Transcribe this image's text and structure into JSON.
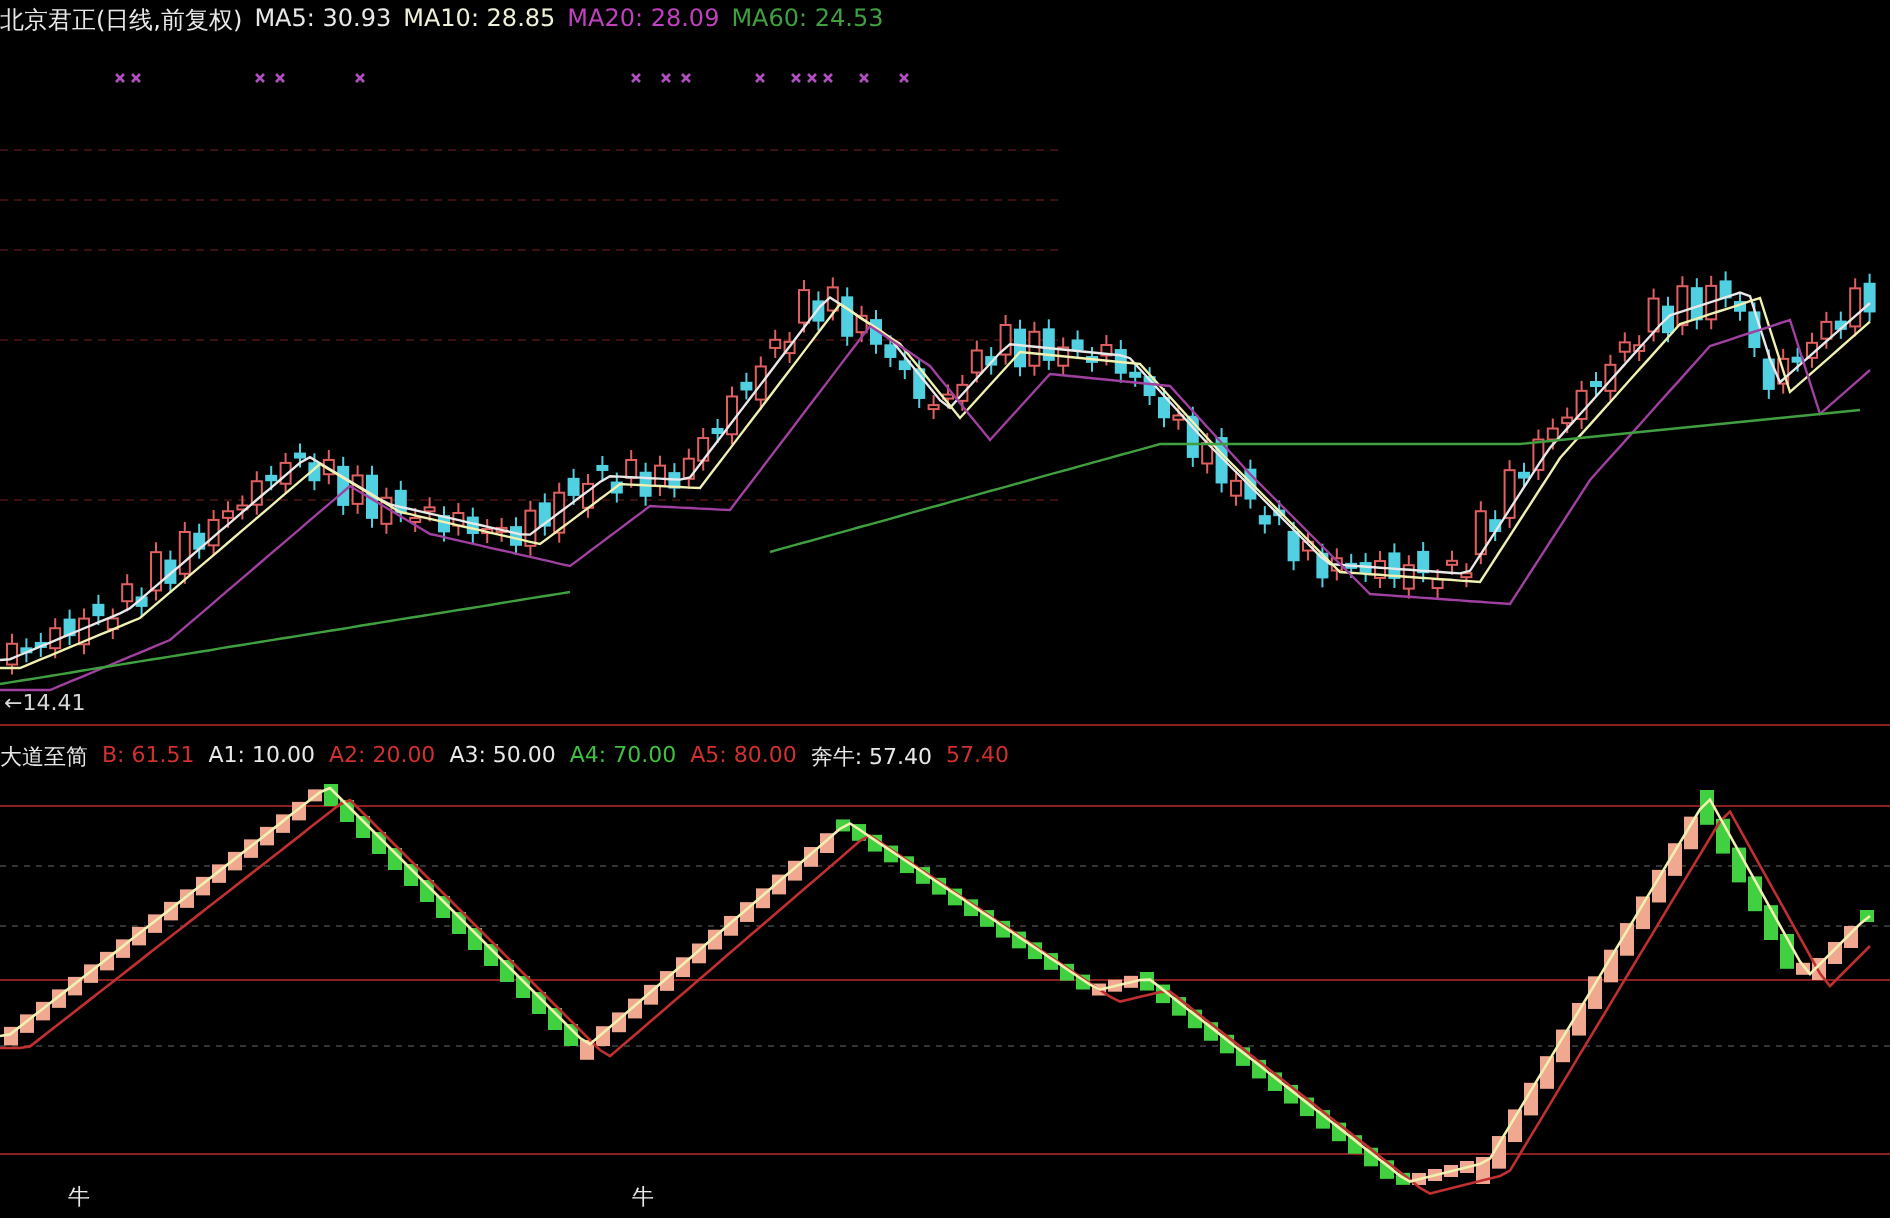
{
  "price_panel": {
    "legend": [
      {
        "text": "北京君正(日线,前复权)",
        "color": "#e8e8e8"
      },
      {
        "text": "MA5: 30.93",
        "color": "#e8e8e8"
      },
      {
        "text": "MA10: 28.85",
        "color": "#f0f0d8"
      },
      {
        "text": "MA20: 28.09",
        "color": "#c040c0"
      },
      {
        "text": "MA60: 24.53",
        "color": "#40a040"
      }
    ],
    "low_label": "←14.41"
  },
  "indicator_panel": {
    "legend": [
      {
        "text": "大道至简",
        "color": "#e8e8e8"
      },
      {
        "text": "B: 61.51",
        "color": "#d03030"
      },
      {
        "text": "A1: 10.00",
        "color": "#e8e8e8"
      },
      {
        "text": "A2: 20.00",
        "color": "#d03030"
      },
      {
        "text": "A3: 50.00",
        "color": "#e8e8e8"
      },
      {
        "text": "A4: 70.00",
        "color": "#40c040"
      },
      {
        "text": "A5: 80.00",
        "color": "#d03030"
      },
      {
        "text": "奔牛: 57.40",
        "color": "#e8e8e8"
      },
      {
        "text": "57.40",
        "color": "#d03030"
      }
    ],
    "signals": [
      {
        "text": "牛"
      },
      {
        "text": "牛"
      }
    ]
  }
}
